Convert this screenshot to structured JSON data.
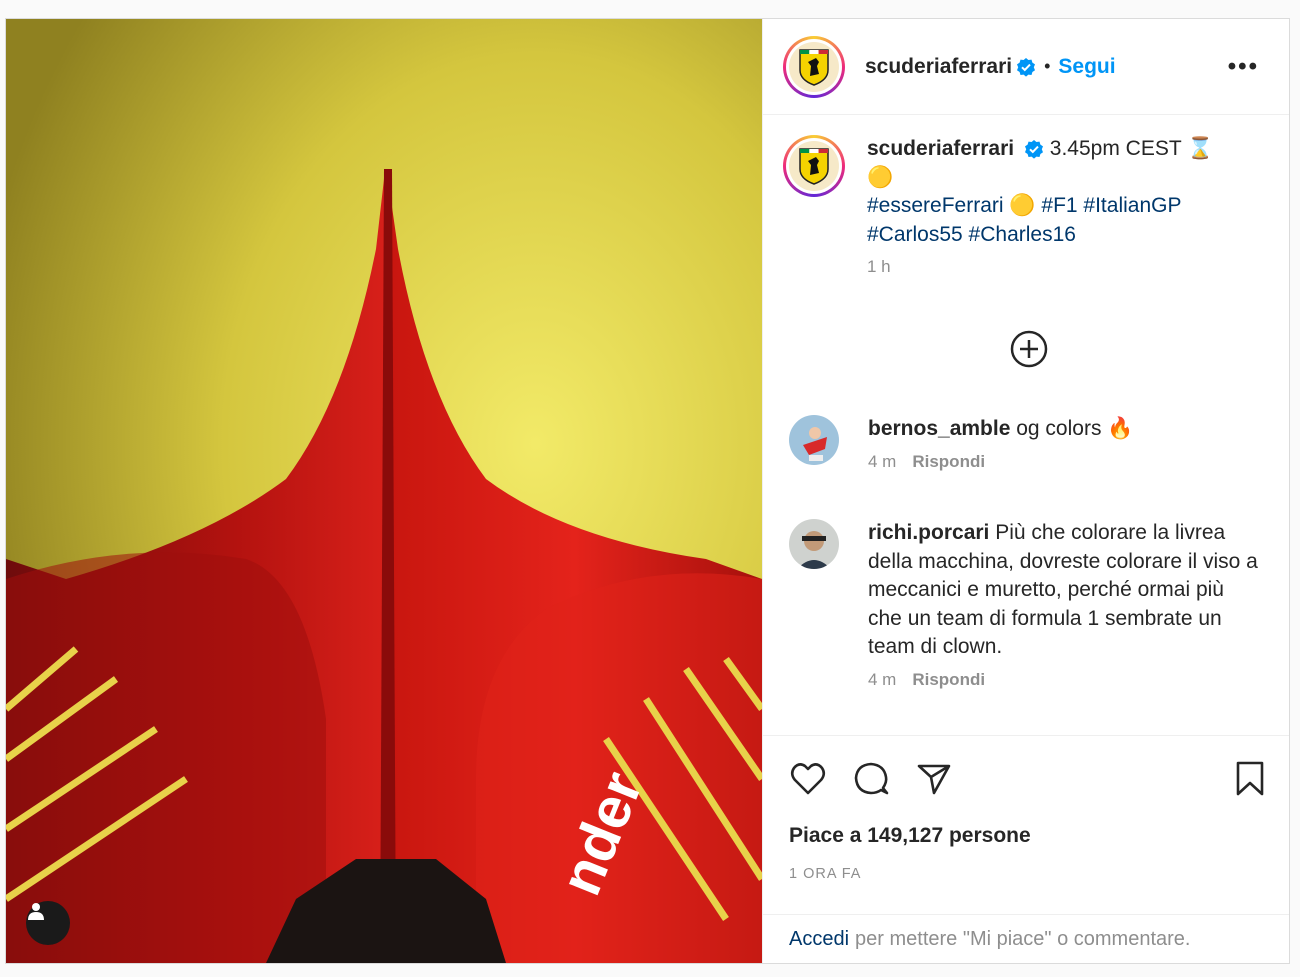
{
  "account": {
    "username": "scuderiaferrari",
    "dot": "•",
    "follow_label": "Segui",
    "more": "•••"
  },
  "caption": {
    "line1_text": "3.45pm CEST ⌛",
    "line2_text": "🟡",
    "hashtags1_a": "#essereFerrari",
    "hashtags1_emoji": "🟡",
    "hashtags1_b": "#F1 #ItalianGP",
    "hashtags2": "#Carlos55 #Charles16",
    "time": "1 h"
  },
  "comments": [
    {
      "user": "bernos_amble",
      "text": "og colors 🔥",
      "time": "4 m",
      "reply": "Rispondi"
    },
    {
      "user": "richi.porcari",
      "text": "Più che colorare la livrea della macchina, dovreste colorare il viso a meccanici e muretto, perché ormai più che un team di formula 1 sembrate un team di clown.",
      "time": "4 m",
      "reply": "Rispondi"
    }
  ],
  "likes_text": "Piace a 149,127 persone",
  "post_time": "1 ORA FA",
  "login": {
    "link": "Accedi",
    "rest": "per mettere \"Mi piace\" o commentare."
  },
  "colors": {
    "follow": "#0095f6",
    "hashtag": "#00376b",
    "ferrari_red": "#c8102e",
    "verified": "#0095f6"
  }
}
